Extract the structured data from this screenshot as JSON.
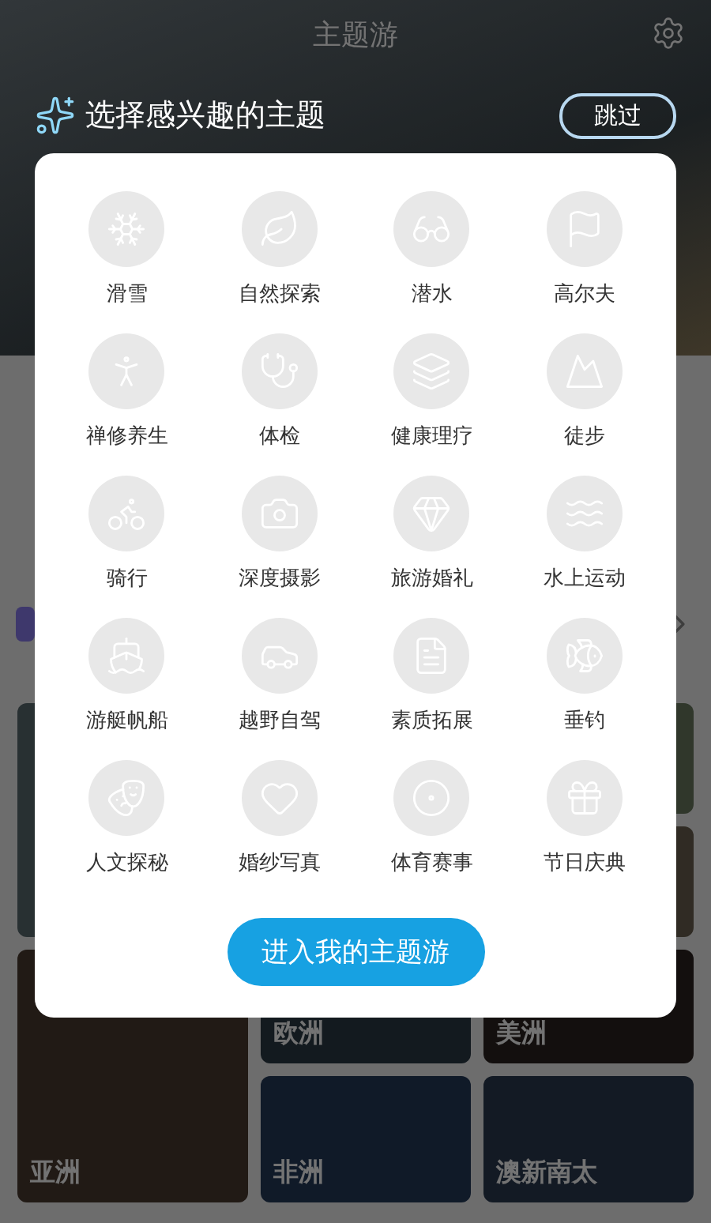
{
  "header": {
    "title": "主题游"
  },
  "prompt": {
    "title": "选择感兴趣的主题",
    "skip_button": "跳过"
  },
  "topics": [
    {
      "label": "滑雪",
      "selected": false
    },
    {
      "label": "自然探索",
      "selected": false
    },
    {
      "label": "潜水",
      "selected": false
    },
    {
      "label": "高尔夫",
      "selected": false
    },
    {
      "label": "禅修养生",
      "selected": false
    },
    {
      "label": "体检",
      "selected": false
    },
    {
      "label": "健康理疗",
      "selected": false
    },
    {
      "label": "徒步",
      "selected": false
    },
    {
      "label": "骑行",
      "selected": false
    },
    {
      "label": "深度摄影",
      "selected": false
    },
    {
      "label": "旅游婚礼",
      "selected": false
    },
    {
      "label": "水上运动",
      "selected": false
    },
    {
      "label": "游艇帆船",
      "selected": false
    },
    {
      "label": "越野自驾",
      "selected": false
    },
    {
      "label": "素质拓展",
      "selected": false
    },
    {
      "label": "垂钓",
      "selected": false
    },
    {
      "label": "人文探秘",
      "selected": false
    },
    {
      "label": "婚纱写真",
      "selected": false
    },
    {
      "label": "体育赛事",
      "selected": false
    },
    {
      "label": "节日庆典",
      "selected": false
    }
  ],
  "cta_button": "进入我的主题游",
  "regions": [
    {
      "label": "欧洲"
    },
    {
      "label": "美洲"
    },
    {
      "label": "亚洲"
    },
    {
      "label": "非洲"
    },
    {
      "label": "澳新南太"
    }
  ]
}
